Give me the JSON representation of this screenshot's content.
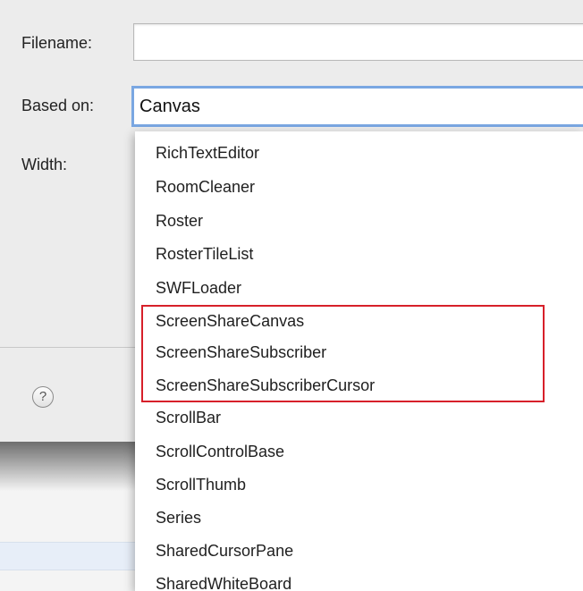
{
  "form": {
    "filename_label": "Filename:",
    "filename_value": "",
    "based_on_label": "Based on:",
    "based_on_value": "Canvas",
    "width_label": "Width:"
  },
  "help": {
    "glyph": "?"
  },
  "dropdown": {
    "items": [
      "RichTextEditor",
      "RoomCleaner",
      "Roster",
      "RosterTileList",
      "SWFLoader",
      "ScreenShareCanvas",
      "ScreenShareSubscriber",
      "ScreenShareSubscriberCursor",
      "ScrollBar",
      "ScrollControlBase",
      "ScrollThumb",
      "Series",
      "SharedCursorPane",
      "SharedWhiteBoard"
    ],
    "highlighted": [
      "ScreenShareCanvas",
      "ScreenShareSubscriber",
      "ScreenShareSubscriberCursor"
    ]
  },
  "colors": {
    "focus_ring": "#7aa7e2",
    "highlight_border": "#d7202a"
  }
}
